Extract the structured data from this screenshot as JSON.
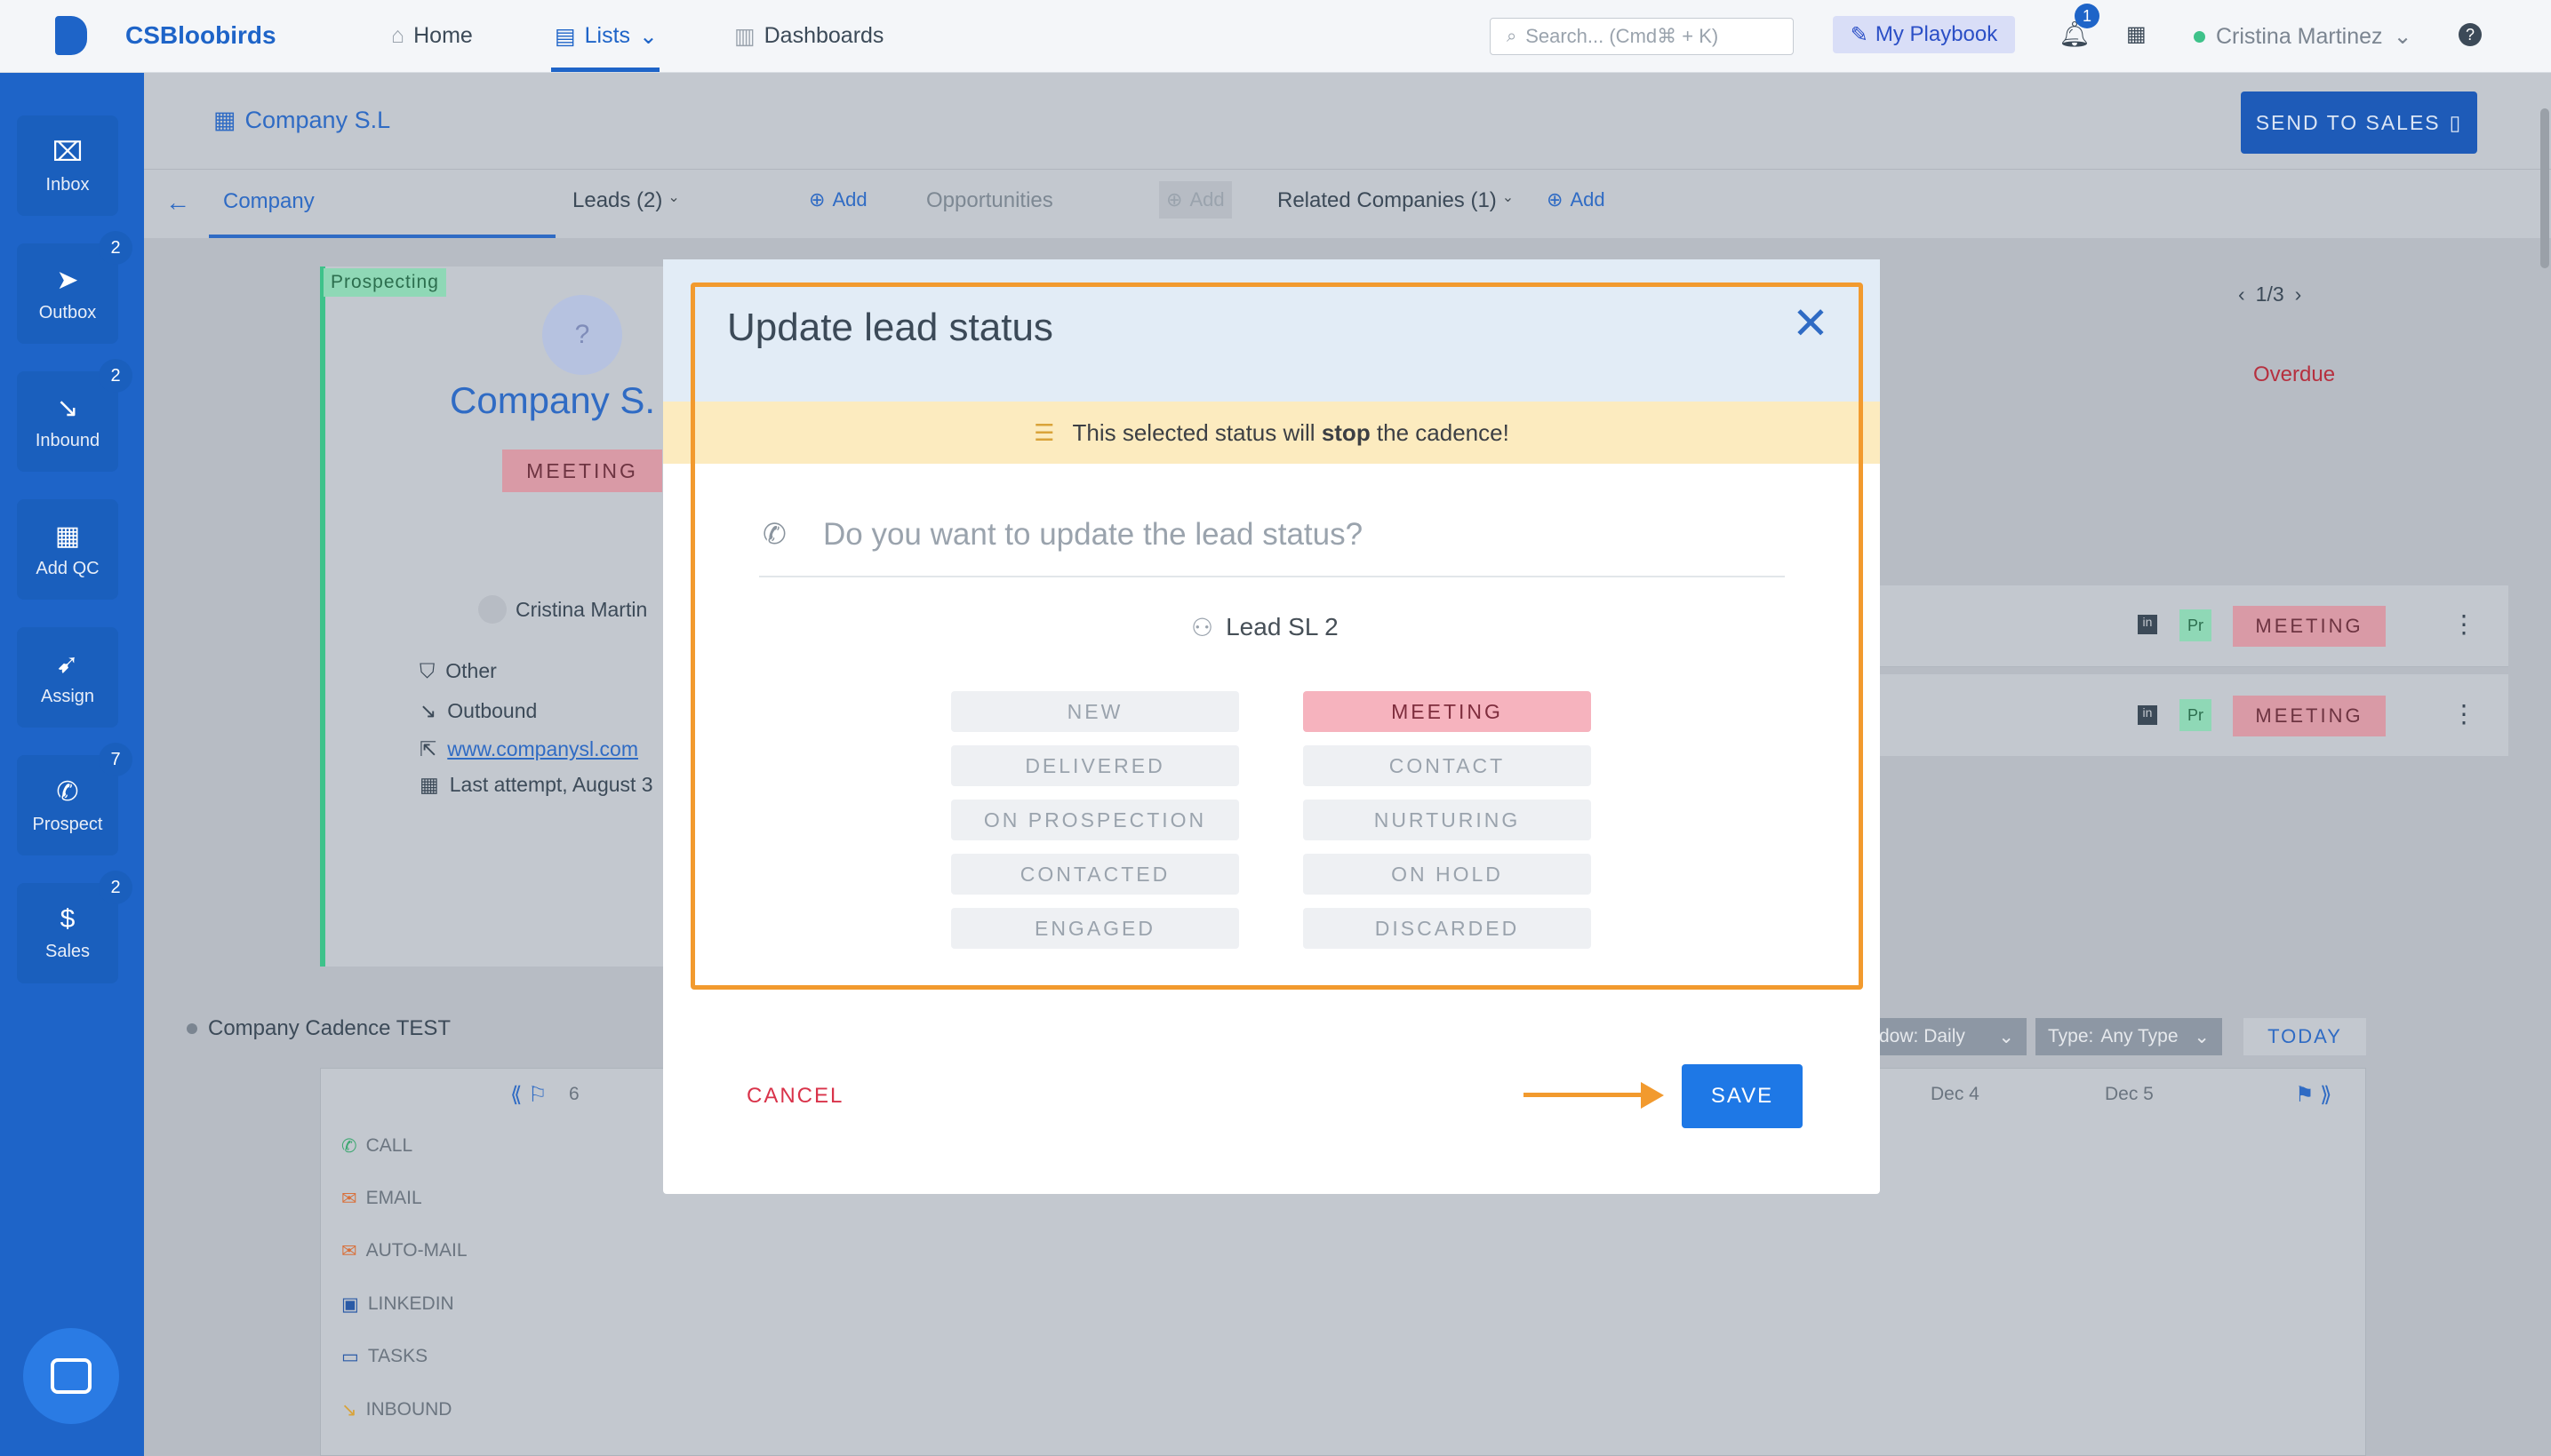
{
  "app": {
    "brand": "CSBloobirds",
    "nav": {
      "home": "Home",
      "lists": "Lists",
      "dashboards": "Dashboards"
    },
    "search_placeholder": "Search... (Cmd⌘ + K)",
    "playbook": "My Playbook",
    "notif_count": "1",
    "user": "Cristina Martinez"
  },
  "sidebar": [
    {
      "label": "Inbox",
      "badge": ""
    },
    {
      "label": "Outbox",
      "badge": "2"
    },
    {
      "label": "Inbound",
      "badge": "2"
    },
    {
      "label": "Add QC",
      "badge": ""
    },
    {
      "label": "Assign",
      "badge": ""
    },
    {
      "label": "Prospect",
      "badge": "7"
    },
    {
      "label": "Sales",
      "badge": "2"
    }
  ],
  "page": {
    "title": "Company S.L",
    "send_to_sales": "SEND TO SALES",
    "tabs": {
      "company": "Company",
      "leads": "Leads (2)",
      "leads_add": "Add",
      "opportunities": "Opportunities",
      "opp_add": "Add",
      "related": "Related Companies (1)",
      "related_add": "Add"
    },
    "card": {
      "stage": "Prospecting",
      "avatar": "?",
      "name": "Company S.",
      "status": "MEETING",
      "owner": "Cristina Martin",
      "source": "Other",
      "direction": "Outbound",
      "website": "www.companysl.com",
      "last_attempt": "Last attempt, August 3"
    },
    "right": {
      "pager": "1/3",
      "overdue": "Overdue",
      "lead_tag": "Pr",
      "lead_status": "MEETING"
    },
    "cadence": {
      "name": "Company Cadence TEST",
      "window": "dow: Daily",
      "type_label": "Type:",
      "type_value": "Any Type",
      "today": "TODAY",
      "day6": "6",
      "dec4": "Dec 4",
      "dec5": "Dec 5",
      "rows": [
        "CALL",
        "EMAIL",
        "AUTO-MAIL",
        "LINKEDIN",
        "TASKS",
        "INBOUND"
      ]
    }
  },
  "modal": {
    "title": "Update lead status",
    "warning_pre": "This selected status will ",
    "warning_bold": "stop",
    "warning_post": " the cadence!",
    "question": "Do you want to update the lead status?",
    "lead": "Lead SL 2",
    "statuses_left": [
      "NEW",
      "DELIVERED",
      "ON PROSPECTION",
      "CONTACTED",
      "ENGAGED"
    ],
    "statuses_right": [
      "MEETING",
      "CONTACT",
      "NURTURING",
      "ON HOLD",
      "DISCARDED"
    ],
    "selected": "MEETING",
    "cancel": "CANCEL",
    "save": "SAVE"
  },
  "colors": {
    "primary": "#1e64c8",
    "highlight": "#f29a2e",
    "meeting": "#f6b3be",
    "cancel": "#d9334a"
  }
}
